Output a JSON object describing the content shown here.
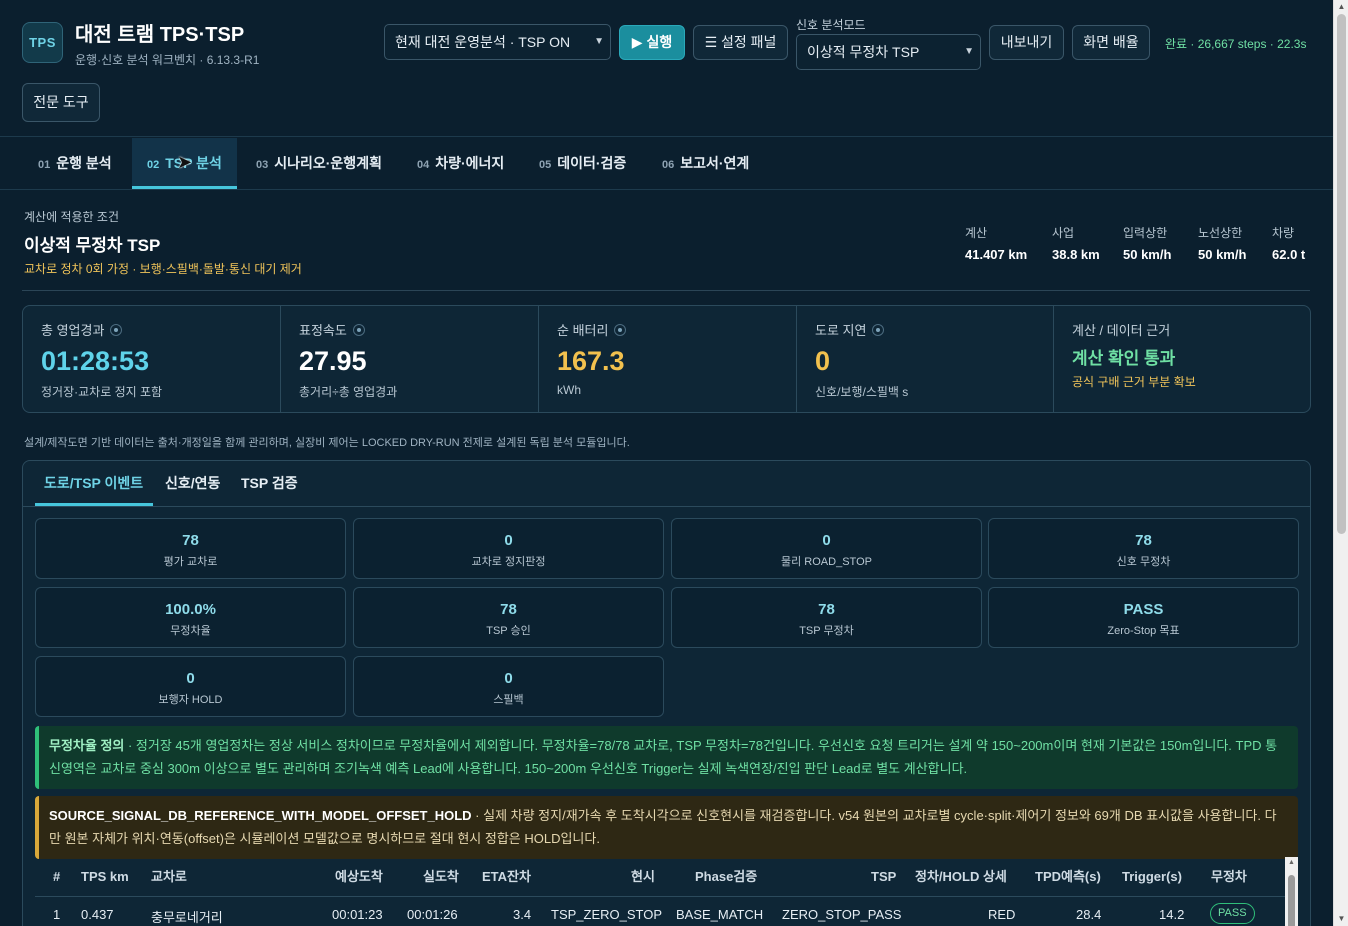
{
  "header": {
    "logo_text": "TPS",
    "title": "대전 트램 TPS·TSP",
    "subtitle": "운행·신호 분석 워크벤치 · 6.13.3-R1",
    "scenario_select": "현재 대전 운영분석 · TSP ON",
    "run_label": "▶ 실행",
    "settings_label": "☰ 설정 패널",
    "signal_mode_label": "신호 분석모드",
    "signal_mode_select": "이상적 무정차 TSP",
    "export_label": "내보내기",
    "layout_label": "화면 배율",
    "status": "완료 · 26,667 steps · 22.3s",
    "expert_label": "전문 도구"
  },
  "tabs": [
    {
      "num": "01",
      "label": "운행 분석"
    },
    {
      "num": "02",
      "label": "TSP 분석"
    },
    {
      "num": "03",
      "label": "시나리오·운행계획"
    },
    {
      "num": "04",
      "label": "차량·에너지"
    },
    {
      "num": "05",
      "label": "데이터·검증"
    },
    {
      "num": "06",
      "label": "보고서·연계"
    }
  ],
  "condition": {
    "label": "계산에 적용한 조건",
    "title": "이상적 무정차 TSP",
    "description": "교차로 정차 0회 가정 · 보행·스필백·돌발·통신 대기 제거",
    "metrics": [
      {
        "key": "계산",
        "value": "41.407 km"
      },
      {
        "key": "사업",
        "value": "38.8 km"
      },
      {
        "key": "입력상한",
        "value": "50 km/h"
      },
      {
        "key": "노선상한",
        "value": "50 km/h"
      },
      {
        "key": "차량",
        "value": "62.0 t"
      }
    ]
  },
  "kpis": [
    {
      "label": "총 영업경과",
      "value": "01:28:53",
      "sub": "정거장·교차로 정지 포함",
      "color": "#5fd3ea"
    },
    {
      "label": "표정속도",
      "value": "27.95",
      "sub": "총거리÷총 영업경과",
      "color": "#ffffff"
    },
    {
      "label": "순 배터리",
      "value": "167.3",
      "sub": "kWh",
      "color": "#f2c14e"
    },
    {
      "label": "도로 지연",
      "value": "0",
      "sub": "신호/보행/스필백 s",
      "color": "#f2c14e"
    }
  ],
  "evidence": {
    "label": "계산 / 데이터 근거",
    "value": "계산 확인 통과",
    "sub": "공식 구배 근거 부분 확보"
  },
  "note": "설계/제작도면 기반 데이터는 출처·개정일을 함께 관리하며, 실장비 제어는 LOCKED DRY-RUN 전제로 설계된 독립 분석 모듈입니다.",
  "subtabs": [
    "도로/TSP 이벤트",
    "신호/연동",
    "TSP 검증"
  ],
  "cards": [
    {
      "value": "78",
      "label": "평가 교차로"
    },
    {
      "value": "0",
      "label": "교차로 정지판정"
    },
    {
      "value": "0",
      "label": "물리 ROAD_STOP"
    },
    {
      "value": "78",
      "label": "신호 무정차"
    },
    {
      "value": "100.0%",
      "label": "무정차율"
    },
    {
      "value": "78",
      "label": "TSP 승인"
    },
    {
      "value": "78",
      "label": "TSP 무정차"
    },
    {
      "value": "PASS",
      "label": "Zero-Stop 목표"
    },
    {
      "value": "0",
      "label": "보행자 HOLD"
    },
    {
      "value": "0",
      "label": "스필백"
    }
  ],
  "alert_green": {
    "title": "무정차율 정의",
    "text": " · 정거장 45개 영업정차는 정상 서비스 정차이므로 무정차율에서 제외합니다. 무정차율=78/78 교차로, TSP 무정차=78건입니다. 우선신호 요청 트리거는 설계 약 150~200m이며 현재 기본값은 150m입니다. TPD 통신영역은 교차로 중심 300m 이상으로 별도 관리하며 조기녹색 예측 Lead에 사용합니다. 150~200m 우선신호 Trigger는 실제 녹색연장/진입 판단 Lead로 별도 계산합니다."
  },
  "alert_yellow": {
    "title": "SOURCE_SIGNAL_DB_REFERENCE_WITH_MODEL_OFFSET_HOLD",
    "text": " · 실제 차량 정지/재가속 후 도착시각으로 신호현시를 재검증합니다. v54 원본의 교차로별 cycle·split·제어기 정보와 69개 DB 표시값을 사용합니다. 다만 원본 자체가 위치·연동(offset)은 시뮬레이션 모델값으로 명시하므로 절대 현시 정합은 HOLD입니다."
  },
  "table": {
    "headers": [
      "#",
      "TPS km",
      "교차로",
      "예상도착",
      "실도착",
      "ETA잔차",
      "현시",
      "Phase검증",
      "TSP",
      "정차/HOLD 상세",
      "TPD예측(s)",
      "Trigger(s)",
      "무정차"
    ],
    "rows": [
      {
        "n": "1",
        "km": "0.437",
        "name": "충무로네거리",
        "eta": "00:01:23",
        "act": "00:01:26",
        "res": "3.4",
        "phase": "TSP_ZERO_STOP",
        "pv": "BASE_MATCH",
        "tsp": "ZERO_STOP_PASS",
        "detail": "RED",
        "tpd": "28.4",
        "trig": "14.2",
        "ns": "PASS"
      }
    ]
  }
}
